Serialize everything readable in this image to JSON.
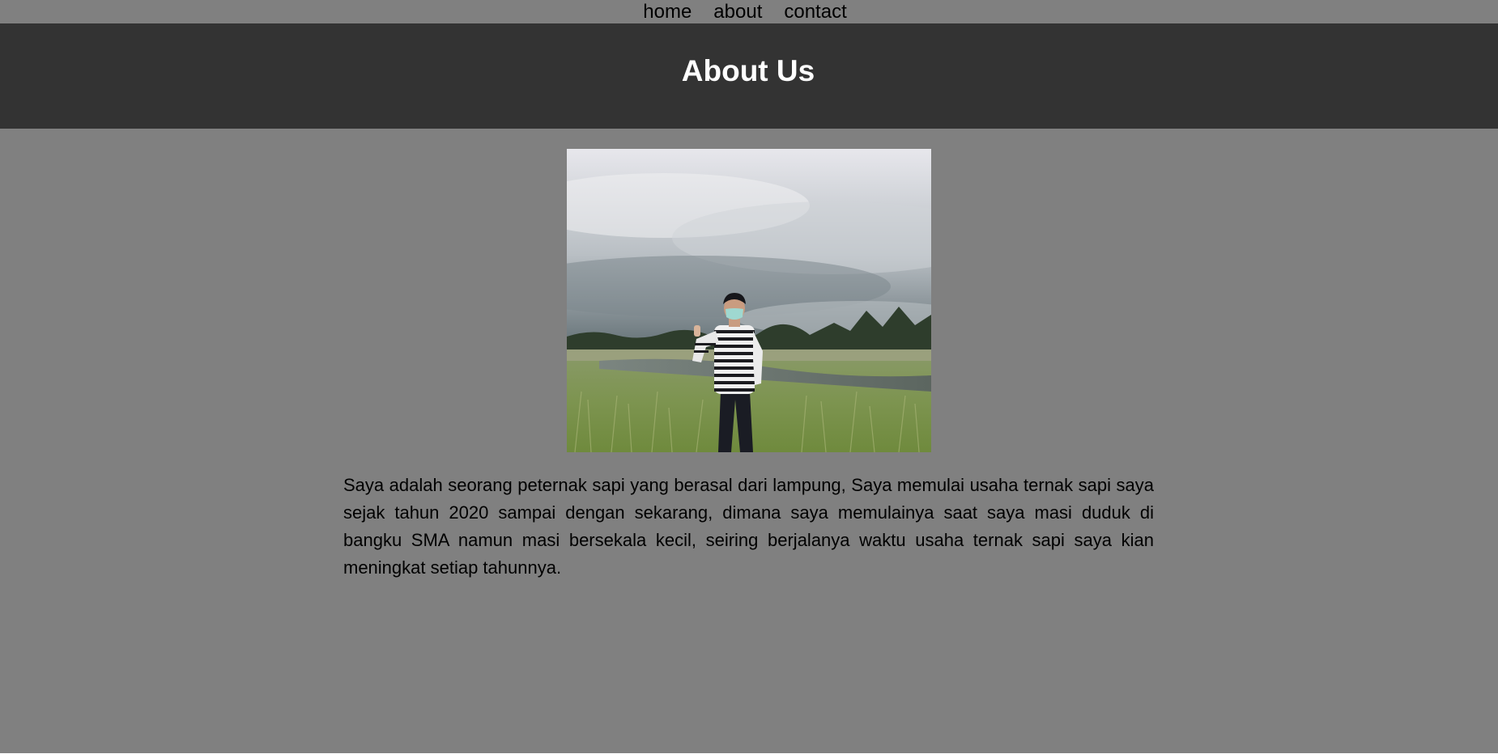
{
  "nav": {
    "items": [
      {
        "label": "home"
      },
      {
        "label": "about"
      },
      {
        "label": "contact"
      }
    ]
  },
  "hero": {
    "title": "About Us"
  },
  "content": {
    "bio": "Saya adalah seorang peternak sapi yang berasal dari lampung, Saya memulai usaha ternak sapi saya sejak tahun 2020 sampai dengan sekarang, dimana saya memulainya saat saya masi duduk di bangku SMA namun masi bersekala kecil, seiring berjalanya waktu usaha ternak sapi saya kian meningkat setiap tahunnya."
  },
  "colors": {
    "page_background": "#808080",
    "hero_background": "#333333",
    "hero_text": "#ffffff",
    "body_text": "#000000"
  }
}
